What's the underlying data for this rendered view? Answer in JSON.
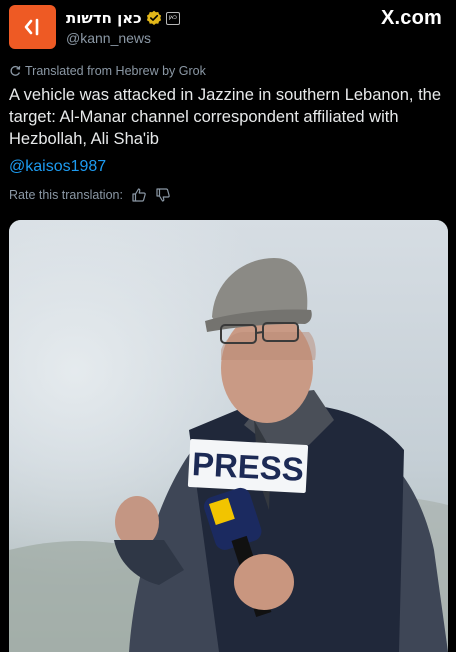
{
  "account": {
    "display_name": "כאן חדשות",
    "handle": "@kann_news",
    "org_badge_text": "כאן",
    "avatar_icon": "kan-logo-icon",
    "avatar_color": "#ee5a24"
  },
  "site": {
    "logo_text": "X.com"
  },
  "tweet": {
    "translated_label": "Translated from Hebrew by Grok",
    "text": "A vehicle was attacked in Jazzine in southern Lebanon, the target: Al-Manar channel correspondent affiliated with Hezbollah, Ali Sha'ib",
    "mention": "@kaisos1987",
    "rate_label": "Rate this translation:"
  },
  "photo": {
    "vest_text": "PRESS"
  },
  "colors": {
    "background": "#000000",
    "text": "#e7e9ea",
    "secondary": "#8b98a5",
    "link": "#1d9bf0"
  }
}
